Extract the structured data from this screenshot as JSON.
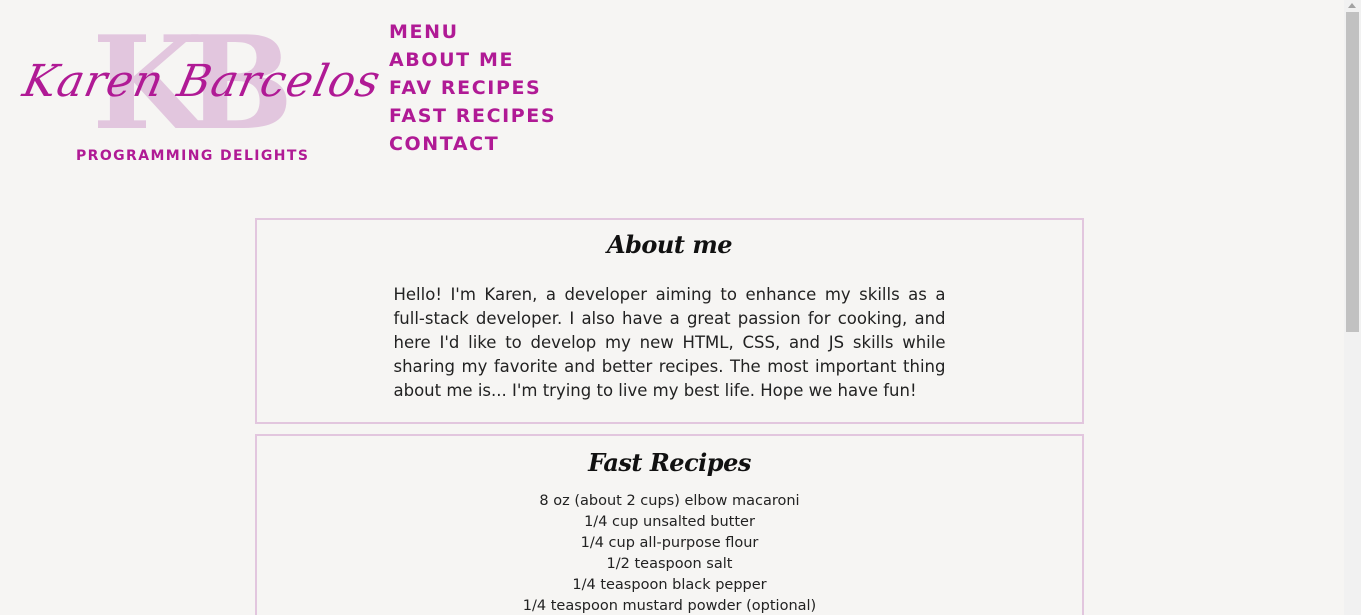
{
  "logo": {
    "monogram": "KB",
    "name": "Karen Barcelos",
    "tagline": "PROGRAMMING DELIGHTS"
  },
  "nav": {
    "items": [
      {
        "label": "MENU"
      },
      {
        "label": "ABOUT ME"
      },
      {
        "label": "FAV RECIPES"
      },
      {
        "label": "FAST RECIPES"
      },
      {
        "label": "CONTACT"
      }
    ]
  },
  "about": {
    "title": "About me",
    "text": "Hello! I'm Karen, a developer aiming to enhance my skills as a full-stack developer. I also have a great passion for cooking, and here I'd like to develop my new HTML, CSS, and JS skills while sharing my favorite and better recipes. The most important thing about me is... I'm trying to live my best life. Hope we have fun!"
  },
  "fast_recipes": {
    "title": "Fast Recipes",
    "ingredients": [
      "8 oz (about 2 cups) elbow macaroni",
      "1/4 cup unsalted butter",
      "1/4 cup all-purpose flour",
      "1/2 teaspoon salt",
      "1/4 teaspoon black pepper",
      "1/4 teaspoon mustard powder (optional)"
    ]
  },
  "colors": {
    "background": "#f6f5f3",
    "accent": "#b01a95",
    "border": "#e2c6de"
  }
}
